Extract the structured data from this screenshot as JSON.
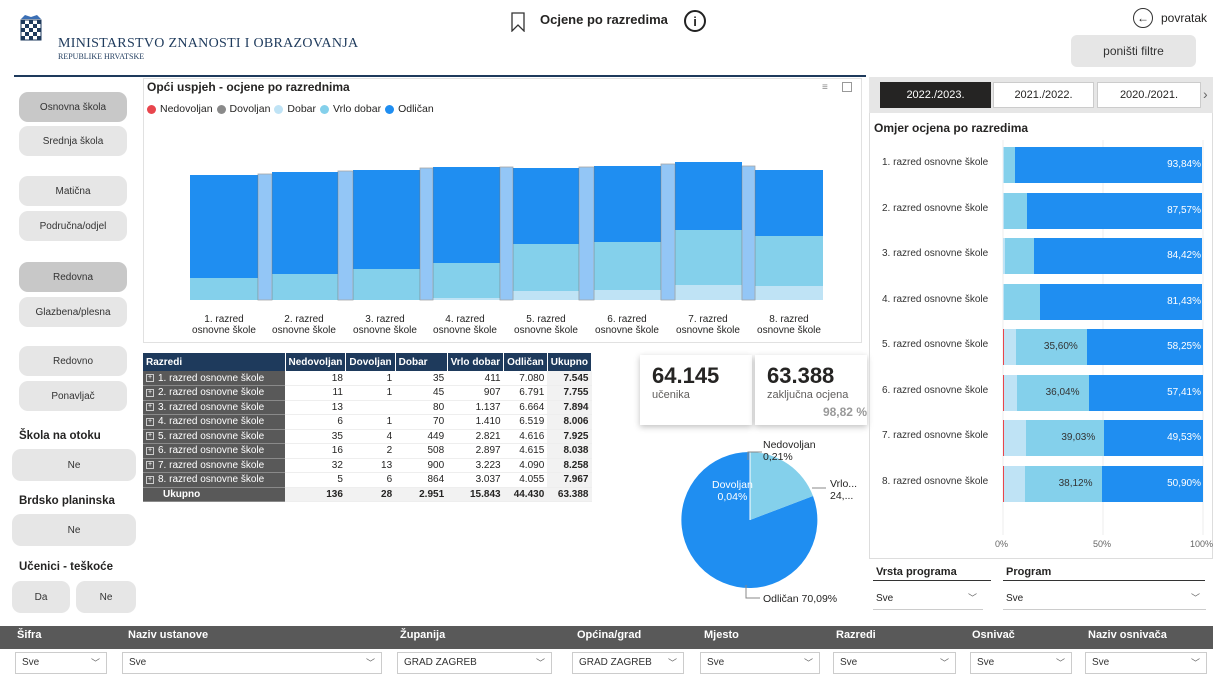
{
  "header": {
    "ministry": "MINISTARSTVO ZNANOSTI I OBRAZOVANJA",
    "republic": "REPUBLIKE HRVATSKE",
    "title": "Ocjene po razredima",
    "back": "povratak",
    "reset": "poništi filtre"
  },
  "left": {
    "b1": "Osnovna škola",
    "b2": "Srednja škola",
    "b3": "Matična",
    "b4": "Područna/odjel",
    "b5": "Redovna",
    "b6": "Glazbena/plesna",
    "b7": "Redovno",
    "b8": "Ponavljač",
    "h1": "Škola na otoku",
    "v1": "Ne",
    "h2": "Brdsko planinska",
    "v2": "Ne",
    "h3": "Učenici - teškoće",
    "v3a": "Da",
    "v3b": "Ne"
  },
  "ribbon": {
    "title": "Opći uspjeh - ocjene po razrednima",
    "legend": [
      "Nedovoljan",
      "Dovoljan",
      "Dobar",
      "Vrlo dobar",
      "Odličan"
    ],
    "c1a": "1. razred",
    "c1b": "osnovne škole",
    "c2a": "2. razred",
    "c2b": "osnovne škole",
    "c3a": "3. razred",
    "c3b": "osnovne škole",
    "c4a": "4. razred",
    "c4b": "osnovne škole",
    "c5a": "5. razred",
    "c5b": "osnovne škole",
    "c6a": "6. razred",
    "c6b": "osnovne škole",
    "c7a": "7. razred",
    "c7b": "osnovne škole",
    "c8a": "8. razred",
    "c8b": "osnovne škole"
  },
  "table": {
    "headers": [
      "Razredi",
      "Nedovoljan",
      "Dovoljan",
      "Dobar",
      "Vrlo dobar",
      "Odličan",
      "Ukupno"
    ],
    "rows": [
      [
        "1. razred osnovne škole",
        "18",
        "1",
        "35",
        "411",
        "7.080",
        "7.545"
      ],
      [
        "2. razred osnovne škole",
        "11",
        "1",
        "45",
        "907",
        "6.791",
        "7.755"
      ],
      [
        "3. razred osnovne škole",
        "13",
        "",
        "80",
        "1.137",
        "6.664",
        "7.894"
      ],
      [
        "4. razred osnovne škole",
        "6",
        "1",
        "70",
        "1.410",
        "6.519",
        "8.006"
      ],
      [
        "5. razred osnovne škole",
        "35",
        "4",
        "449",
        "2.821",
        "4.616",
        "7.925"
      ],
      [
        "6. razred osnovne škole",
        "16",
        "2",
        "508",
        "2.897",
        "4.615",
        "8.038"
      ],
      [
        "7. razred osnovne škole",
        "32",
        "13",
        "900",
        "3.223",
        "4.090",
        "8.258"
      ],
      [
        "8. razred osnovne škole",
        "5",
        "6",
        "864",
        "3.037",
        "4.055",
        "7.967"
      ]
    ],
    "total": [
      "Ukupno",
      "136",
      "28",
      "2.951",
      "15.843",
      "44.430",
      "63.388"
    ]
  },
  "cards": {
    "n1": "64.145",
    "l1": "učenika",
    "n2": "63.388",
    "l2": "zaključna ocjena",
    "pct": "98,82 %"
  },
  "pie": {
    "nedov": "Nedovoljan",
    "nedovp": "0,21%",
    "dov": "Dovoljan",
    "dovp": "0,04%",
    "vrlo": "Vrlo...",
    "vrlop": "24,...",
    "odl": "Odličan 70,09%"
  },
  "right": {
    "tabs": [
      "2022./2023.",
      "2021./2022.",
      "2020./2021."
    ],
    "title": "Omjer ocjena po razredima",
    "cats": [
      "1. razred osnovne škole",
      "2. razred osnovne škole",
      "3. razred osnovne škole",
      "4. razred osnovne škole",
      "5. razred osnovne škole",
      "6. razred osnovne škole",
      "7. razred osnovne škole",
      "8. razred osnovne škole"
    ],
    "axis": [
      "0%",
      "50%",
      "100%"
    ],
    "vrsta": "Vrsta programa",
    "program": "Program",
    "sve": "Sve"
  },
  "filters": {
    "sifra": "Šifra",
    "naziv": "Naziv ustanove",
    "zup": "Županija",
    "opc": "Općina/grad",
    "mj": "Mjesto",
    "raz": "Razredi",
    "osn": "Osnivač",
    "nazosn": "Naziv osnivača",
    "sve": "Sve",
    "zupv": "GRAD ZAGREB",
    "opcv": "GRAD ZAGREB"
  },
  "colors": {
    "nedovoljan": "#e8464d",
    "dovoljan": "#8a8a8a",
    "dobar": "#bfe3f5",
    "vrlo": "#84d0eb",
    "odlican": "#1f8ef1"
  },
  "chart_data": [
    {
      "type": "bar",
      "title": "Omjer ocjena po razredima",
      "categories": [
        "1. razred osnovne škole",
        "2. razred osnovne škole",
        "3. razred osnovne škole",
        "4. razred osnovne škole",
        "5. razred osnovne škole",
        "6. razred osnovne škole",
        "7. razred osnovne škole",
        "8. razred osnovne škole"
      ],
      "series": [
        {
          "name": "Vrlo dobar",
          "values": [
            5.4,
            11.7,
            14.4,
            17.6,
            35.6,
            36.04,
            39.03,
            38.12
          ]
        },
        {
          "name": "Odličan",
          "values": [
            93.84,
            87.57,
            84.42,
            81.43,
            58.25,
            57.41,
            49.53,
            50.9
          ]
        }
      ]
    },
    {
      "type": "pie",
      "title": "",
      "slices": [
        {
          "name": "Nedovoljan",
          "value": 0.21
        },
        {
          "name": "Dovoljan",
          "value": 0.04
        },
        {
          "name": "Vrlo dobar",
          "value": 24.99
        },
        {
          "name": "Odličan",
          "value": 70.09
        }
      ]
    }
  ]
}
